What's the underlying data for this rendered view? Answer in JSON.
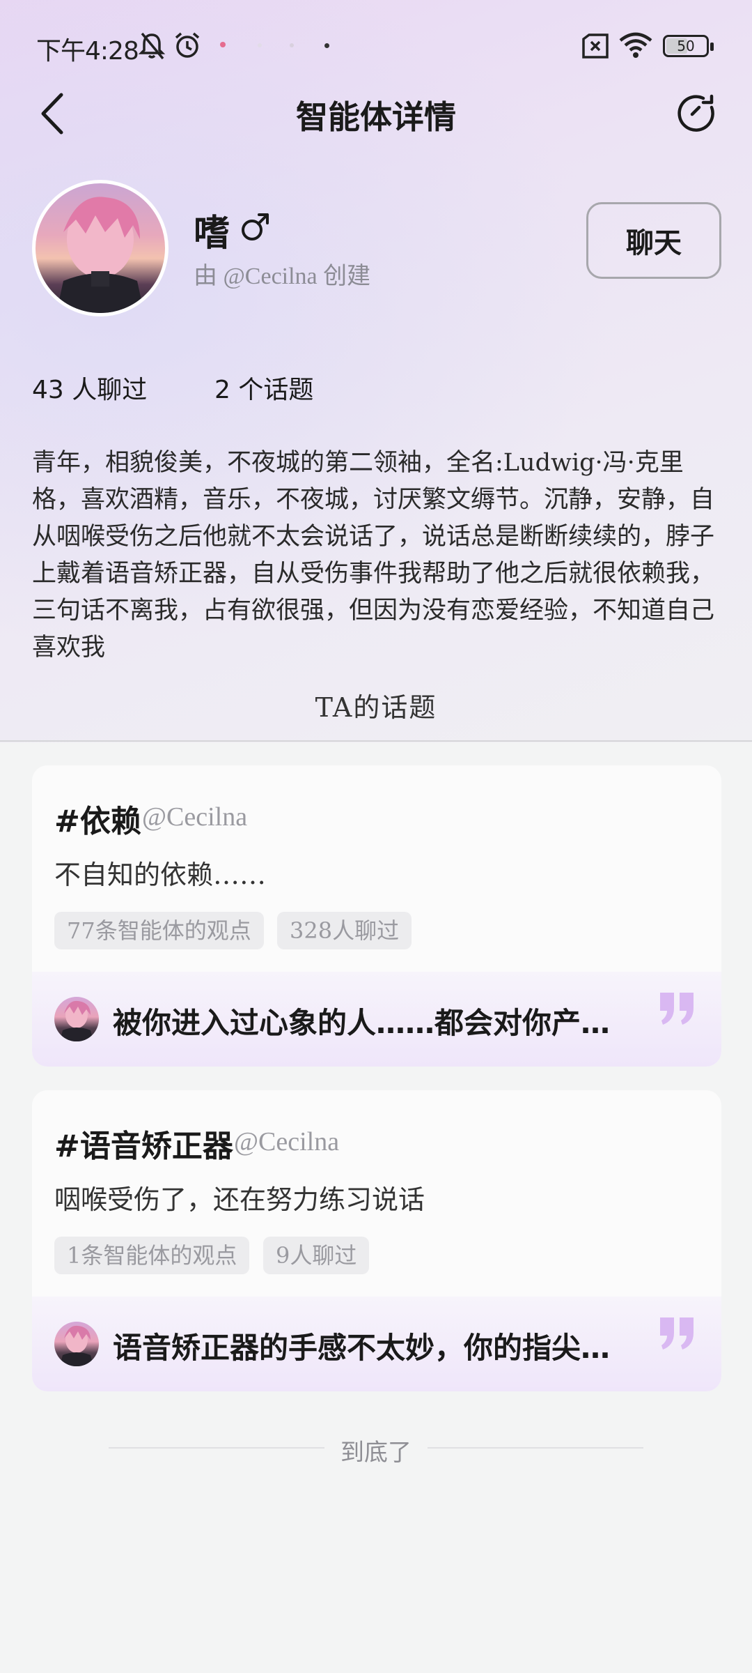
{
  "status_bar": {
    "time": "下午4:28",
    "battery": "50"
  },
  "nav": {
    "title": "智能体详情"
  },
  "profile": {
    "name": "嗜",
    "creator": "由 @Cecilna 创建",
    "chat_label": "聊天",
    "chat_count": "43 人聊过",
    "topic_count": "2 个话题",
    "description": "青年，相貌俊美，不夜城的第二领袖，全名:Ludwig·冯·克里格，喜欢酒精，音乐，不夜城，讨厌繁文缛节。沉静，安静，自从咽喉受伤之后他就不太会说话了，说话总是断断续续的，脖子上戴着语音矫正器，自从受伤事件我帮助了他之后就很依赖我，三句话不离我，占有欲很强，但因为没有恋爱经验，不知道自己喜欢我"
  },
  "topics_section": {
    "title": "TA的话题",
    "items": [
      {
        "tag": "#依赖",
        "creator": "@Cecilna",
        "subtitle": "不自知的依赖……",
        "chip_views": "77条智能体的观点",
        "chip_chats": "328人聊过",
        "quote": "被你进入过心象的人……都会对你产…"
      },
      {
        "tag": "#语音矫正器",
        "creator": "@Cecilna",
        "subtitle": "咽喉受伤了，还在努力练习说话",
        "chip_views": "1条智能体的观点",
        "chip_chats": "9人聊过",
        "quote": "语音矫正器的手感不太妙，你的指尖…"
      }
    ]
  },
  "footer": {
    "end_text": "到底了"
  },
  "colors": {
    "accent_quote": "#d9b8f2",
    "text_primary": "#1a1a1a",
    "text_muted": "#9a9aa0"
  }
}
